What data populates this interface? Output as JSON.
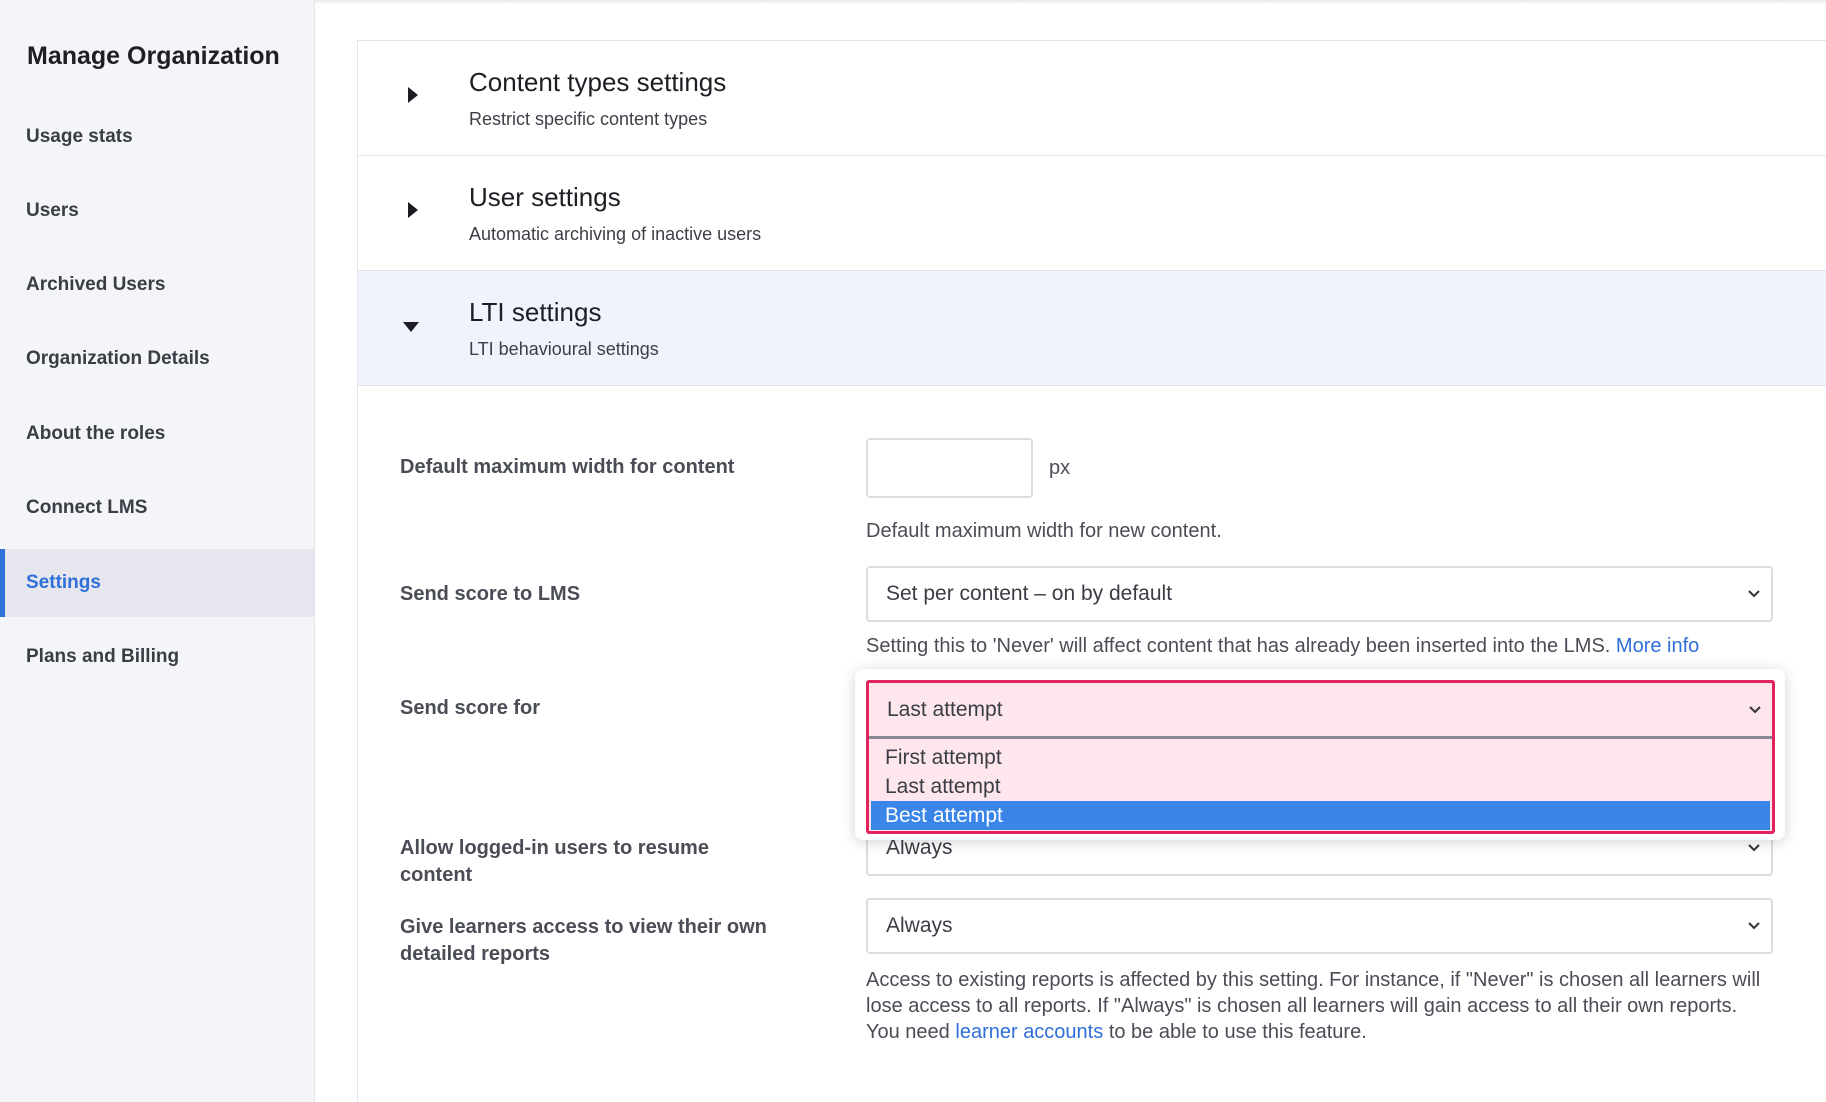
{
  "sidebar": {
    "title": "Manage Organization",
    "items": [
      {
        "label": "Usage stats"
      },
      {
        "label": "Users"
      },
      {
        "label": "Archived Users"
      },
      {
        "label": "Organization Details"
      },
      {
        "label": "About the roles"
      },
      {
        "label": "Connect LMS"
      },
      {
        "label": "Settings",
        "active": true
      },
      {
        "label": "Plans and Billing"
      }
    ]
  },
  "sections": [
    {
      "title": "Content types settings",
      "subtitle": "Restrict specific content types",
      "expanded": false
    },
    {
      "title": "User settings",
      "subtitle": "Automatic archiving of inactive users",
      "expanded": false
    },
    {
      "title": "LTI settings",
      "subtitle": "LTI behavioural settings",
      "expanded": true
    }
  ],
  "lti": {
    "max_width": {
      "label": "Default maximum width for content",
      "value": "",
      "unit": "px",
      "help": "Default maximum width for new content."
    },
    "send_score": {
      "label": "Send score to LMS",
      "value": "Set per content – on by default",
      "help": "Setting this to 'Never' will affect content that has already been inserted into the LMS.",
      "help_link": "More info"
    },
    "send_score_for": {
      "label": "Send score for",
      "value": "Last attempt",
      "options": [
        "First attempt",
        "Last attempt",
        "Best attempt"
      ],
      "highlighted_option": "Best attempt"
    },
    "resume": {
      "label": "Allow logged-in users to resume content",
      "value": "Always"
    },
    "reports": {
      "label": "Give learners access to view their own detailed reports",
      "value": "Always",
      "help_before": "Access to existing reports is affected by this setting. For instance, if \"Never\" is chosen all learners will lose access to all reports. If \"Always\" is chosen all learners will gain access to all their own reports. You need",
      "help_link": "learner accounts",
      "help_after": "to be able to use this feature."
    }
  },
  "colors": {
    "accent": "#2f6fd8",
    "highlight_border": "#e2245e",
    "highlight_bg": "#fde6ec",
    "selected_option": "#3a86e8"
  }
}
